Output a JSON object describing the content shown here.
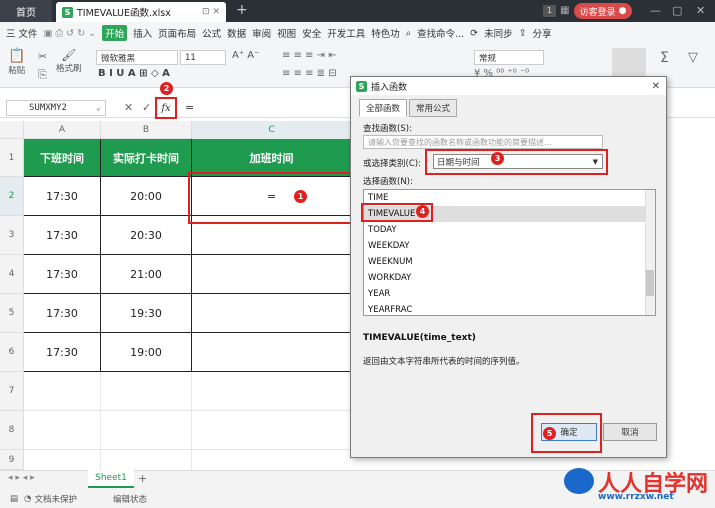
{
  "tabbar": {
    "home": "首页",
    "file": "TIMEVALUE函数.xlsx",
    "badge": "1",
    "login": "访客登录"
  },
  "ribbon": {
    "menus": [
      "三 文件",
      "开始",
      "插入",
      "页面布局",
      "公式",
      "数据",
      "审阅",
      "视图",
      "安全",
      "开发工具",
      "特色功"
    ],
    "search": "查找命令...",
    "sync": "未同步",
    "share": "分享",
    "font": "微软雅黑",
    "size": "11",
    "format": "常规",
    "paste": "粘贴",
    "brush": "格式刷"
  },
  "formula_bar": {
    "namebox": "SUMXMY2",
    "fx": "fx",
    "content": "="
  },
  "sheet": {
    "columns": [
      "A",
      "B",
      "C"
    ],
    "rows": [
      "1",
      "2",
      "3",
      "4",
      "5",
      "6",
      "7",
      "8",
      "9"
    ],
    "headers": [
      "下班时间",
      "实际打卡时间",
      "加班时间"
    ],
    "data": [
      [
        "17:30",
        "20:00",
        "="
      ],
      [
        "17:30",
        "20:30",
        ""
      ],
      [
        "17:30",
        "21:00",
        ""
      ],
      [
        "17:30",
        "19:30",
        ""
      ],
      [
        "17:30",
        "19:00",
        ""
      ]
    ],
    "tab": "Sheet1"
  },
  "status": {
    "protect": "文档未保护",
    "mode": "编辑状态"
  },
  "dialog": {
    "title": "插入函数",
    "tabs": [
      "全部函数",
      "常用公式"
    ],
    "search_label": "查找函数(S):",
    "search_placeholder": "请输入您要查找的函数名称或函数功能的简要描述...",
    "category_label": "或选择类别(C):",
    "category": "日期与时间",
    "select_label": "选择函数(N):",
    "functions": [
      "TIME",
      "TIMEVALUE",
      "TODAY",
      "WEEKDAY",
      "WEEKNUM",
      "WORKDAY",
      "YEAR",
      "YEARFRAC"
    ],
    "signature": "TIMEVALUE(time_text)",
    "description": "返回由文本字符串所代表的时间的序列值。",
    "ok": "确定",
    "cancel": "取消"
  },
  "markers": [
    "1",
    "2",
    "3",
    "4",
    "5"
  ],
  "watermark": {
    "text": "人人自学网",
    "url": "www.rrzxw.net"
  },
  "colors": {
    "accent": "#2fa55a",
    "header_green": "#1f9b4f",
    "marker_red": "#e02020"
  }
}
